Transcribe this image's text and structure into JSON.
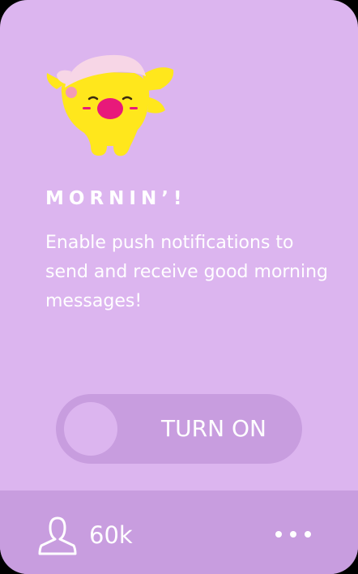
{
  "card": {
    "title": "MORNIN’!",
    "description": "Enable push notifications to send and receive good morning messages!",
    "mascot_icon": "sleepy-yellow-creature-icon"
  },
  "toggle": {
    "label": "TURN ON",
    "state": "off"
  },
  "footer": {
    "user_icon": "user-icon",
    "follower_count": "60k",
    "more_icon": "ellipsis-icon"
  },
  "colors": {
    "card_background": "#dcb5ef",
    "footer_background": "#c89ddf",
    "mascot_body": "#ffe71c",
    "mascot_hat": "#f7d6e6",
    "mascot_nose": "#e8197a"
  }
}
